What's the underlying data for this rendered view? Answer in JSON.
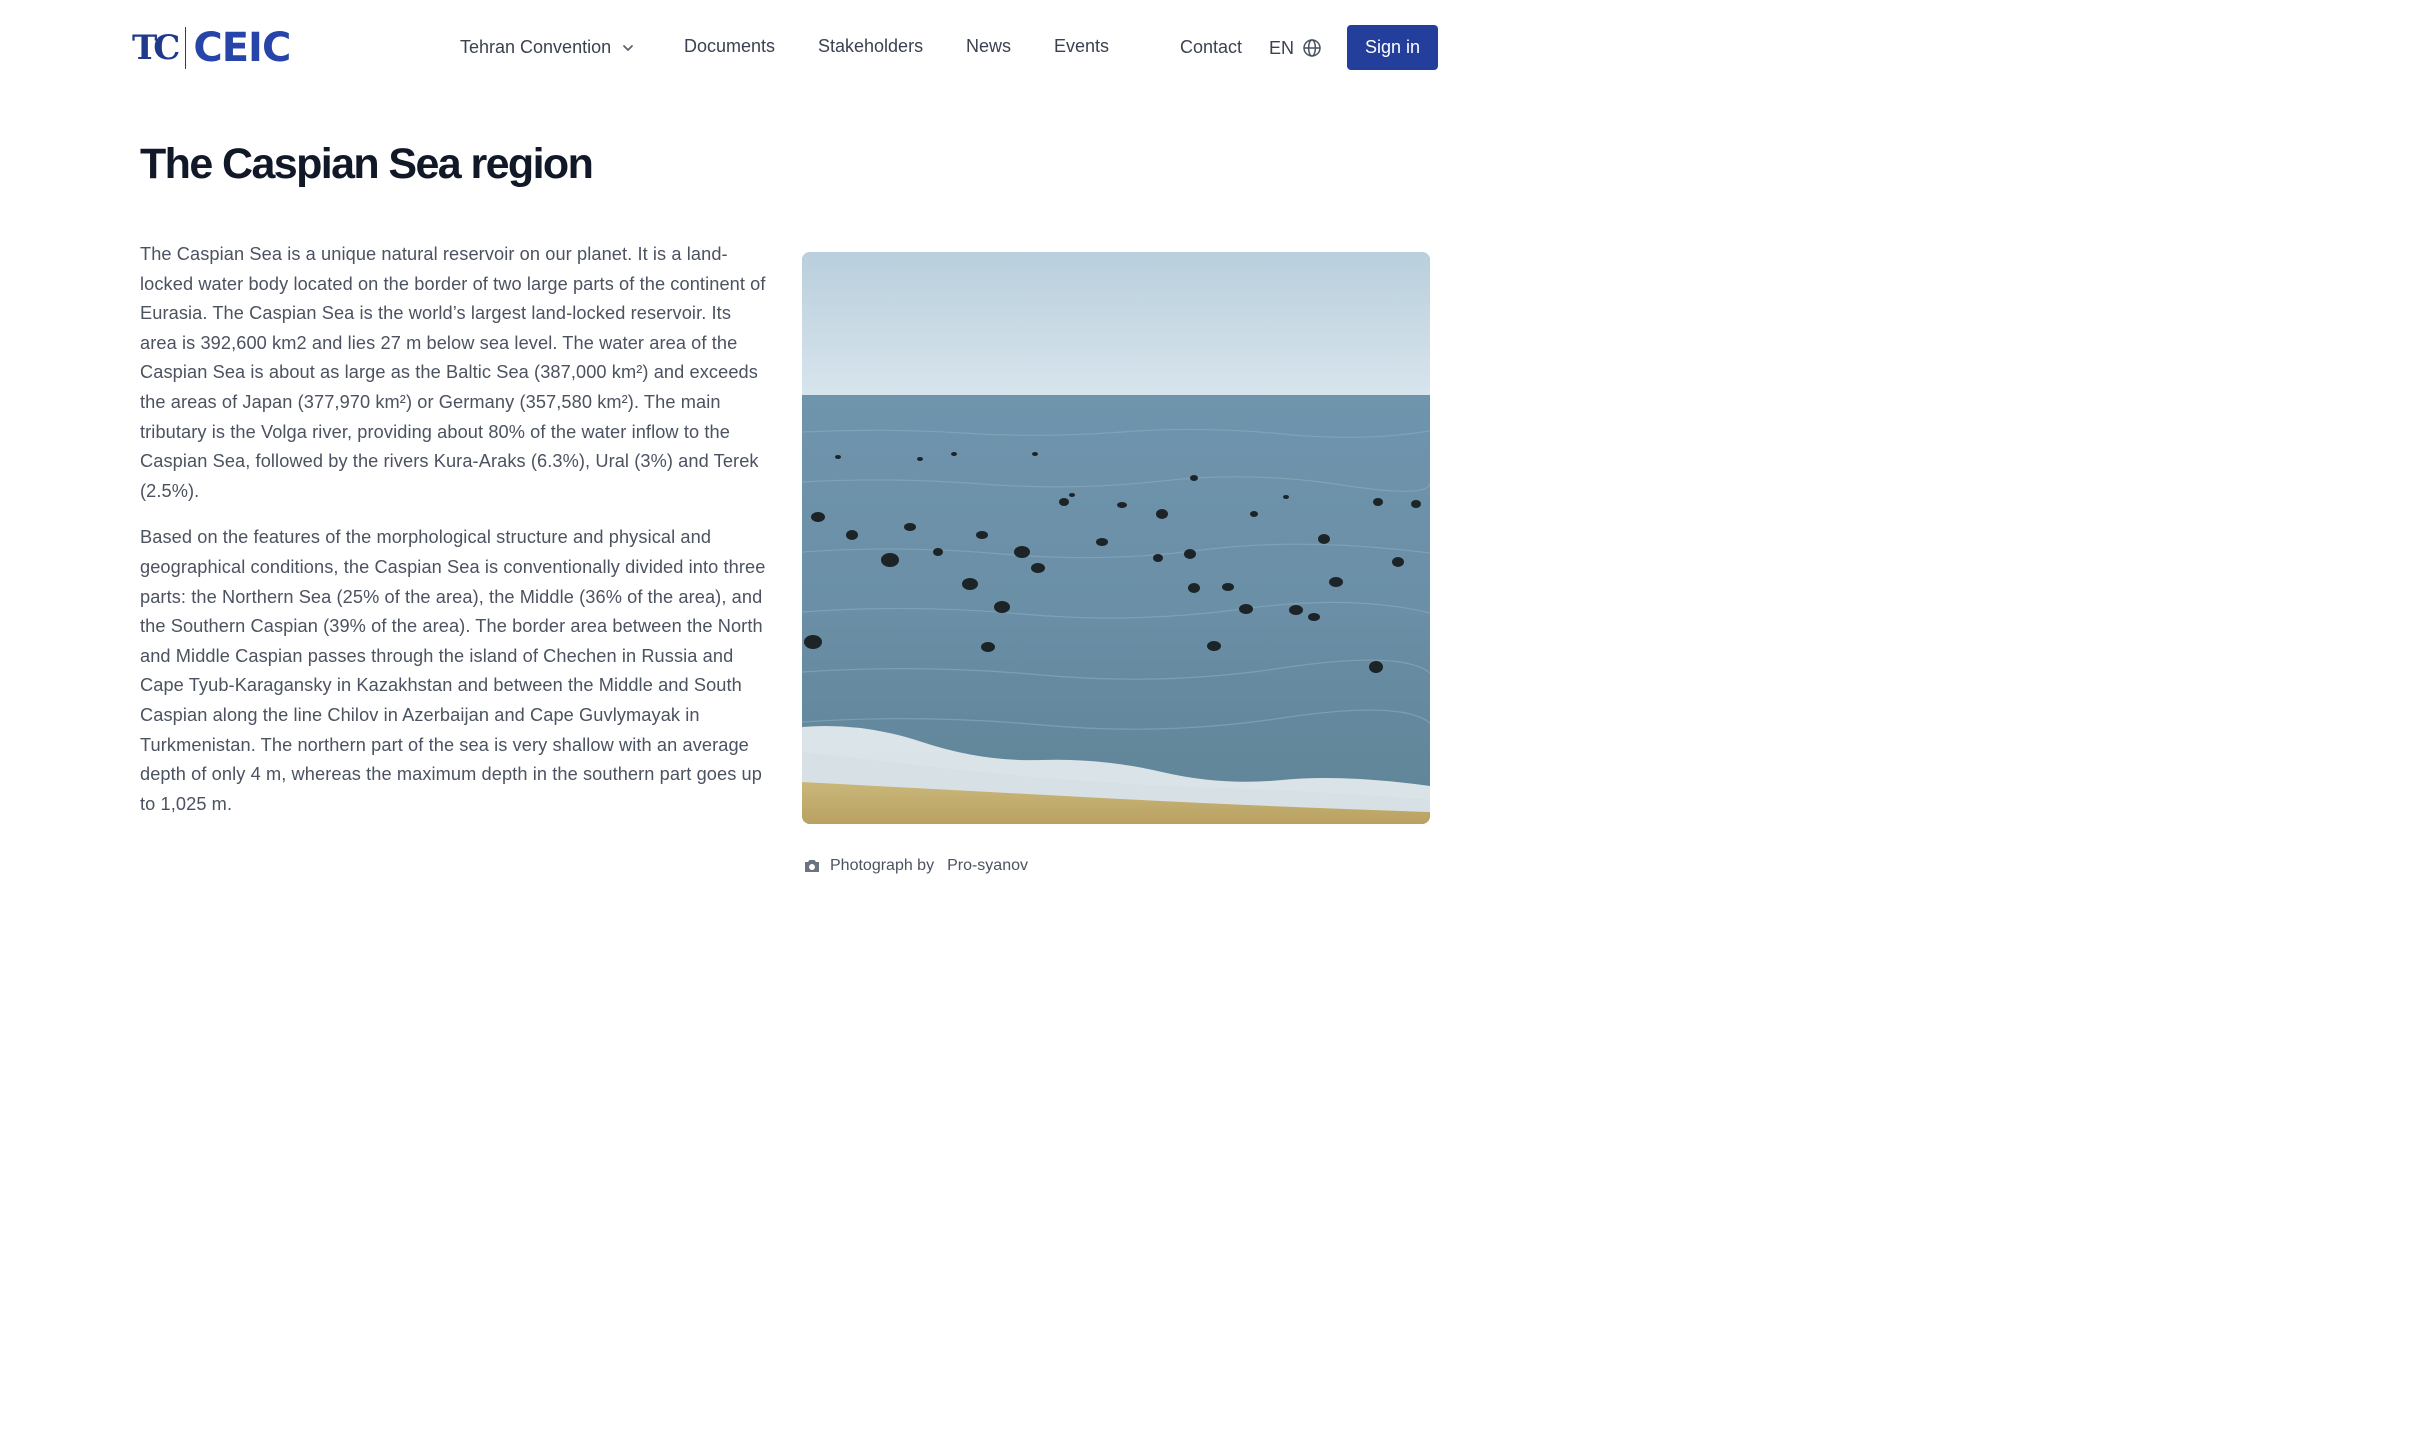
{
  "header": {
    "logo": {
      "left": "TC",
      "right": "CEIC"
    },
    "nav": {
      "tehran_convention": "Tehran Convention",
      "documents": "Documents",
      "stakeholders": "Stakeholders",
      "news": "News",
      "events": "Events",
      "contact": "Contact"
    },
    "language": "EN",
    "sign_in": "Sign in"
  },
  "page": {
    "title": "The Caspian Sea region",
    "paragraphs": [
      "The Caspian Sea is a unique natural reservoir on our planet. It is a land-locked water body located on the border of two large parts of the continent of Eurasia. The Caspian Sea is the world’s largest land-locked reservoir. Its area is 392,600 km2 and lies 27 m below sea level. The water area of the Caspian Sea is about as large as the Baltic Sea (387,000 km²) and exceeds the areas of Japan (377,970 km²) or Germany (357,580 km²). The main tributary is the Volga river, providing about 80% of the water inflow to the Caspian Sea, followed by the rivers Kura-Araks (6.3%), Ural (3%) and Terek (2.5%).",
      "Based on the features of the morphological structure and physical and geographical conditions, the Caspian Sea is conventionally divided into three parts: the Northern Sea (25% of the area), the Middle (36% of the area), and the Southern Caspian (39% of the area). The border area between the North and Middle Caspian passes through the island of Chechen in Russia and Cape Tyub-Karagansky in Kazakhstan and between the Middle and South Caspian along the line Chilov in Azerbaijan and Cape Guvlymayak in Turkmenistan. The northern part of the sea is very shallow with an average depth of only 4 m, whereas the maximum depth in the southern part goes up to 1,025 m."
    ],
    "photo": {
      "caption_label": "Photograph by",
      "credit": "Pro-syanov"
    }
  },
  "colors": {
    "brand": "#233e9b",
    "title": "#111827",
    "body_text": "#4b5260"
  },
  "icons": {
    "nav_dropdown": "chevron-down-icon",
    "language": "globe-icon",
    "caption": "camera-icon"
  }
}
